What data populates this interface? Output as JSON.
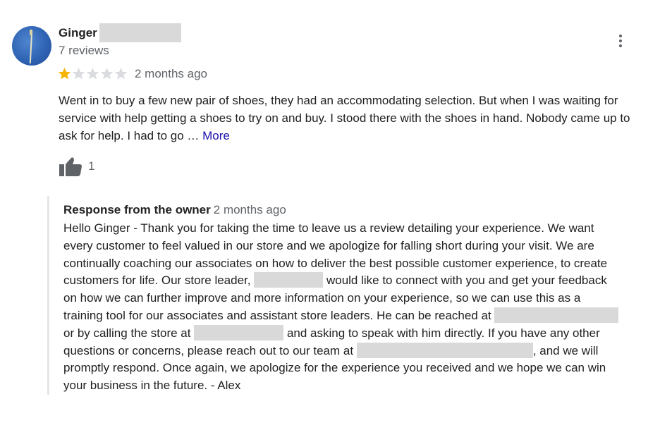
{
  "review": {
    "reviewer_name": "Ginger",
    "review_count": "7 reviews",
    "rating": 1,
    "max_rating": 5,
    "date": "2 months ago",
    "text": "Went in to buy a few new pair of shoes, they had an accommodating selection. But when I was waiting for service with help getting a shoes to try on and buy. I stood there with the shoes in hand. Nobody came up to ask for help. I had to go …",
    "more_label": "More",
    "like_count": "1"
  },
  "response": {
    "title": "Response from the owner",
    "date": "2 months ago",
    "lines": [
      "Hello Ginger - Thank you for taking the time to leave us a review detailing your experience. We want",
      "every customer to feel valued in our store and we apologize for falling short during your visit. We are",
      "continually coaching our associates on how to deliver the best possible customer experience, to create",
      [
        "customers for life. Our store leader,",
        " would like to connect with you and get your feedback"
      ],
      "on how we can further improve and more information on your experience, so we can use this as a",
      "training tool for our associates and assistant store leaders. He can be reached at",
      [
        "or by calling the store at",
        " and asking to speak with him directly. If you have any other"
      ],
      [
        "questions or concerns, please reach out to our team at",
        ", and we will"
      ],
      "promptly respond. Once again, we apologize for the experience you received and we hope we can win",
      "your business in the future. - Alex"
    ]
  },
  "icons": {
    "more_menu": "more-vert-icon",
    "thumb": "thumb-up-icon",
    "star_filled": "star-filled-icon",
    "star_empty": "star-empty-icon"
  },
  "colors": {
    "star_filled": "#f4b400",
    "star_empty": "#dadce0",
    "link": "#1a0dab",
    "secondary_text": "#5f6368",
    "redaction": "#d9d9d9"
  }
}
